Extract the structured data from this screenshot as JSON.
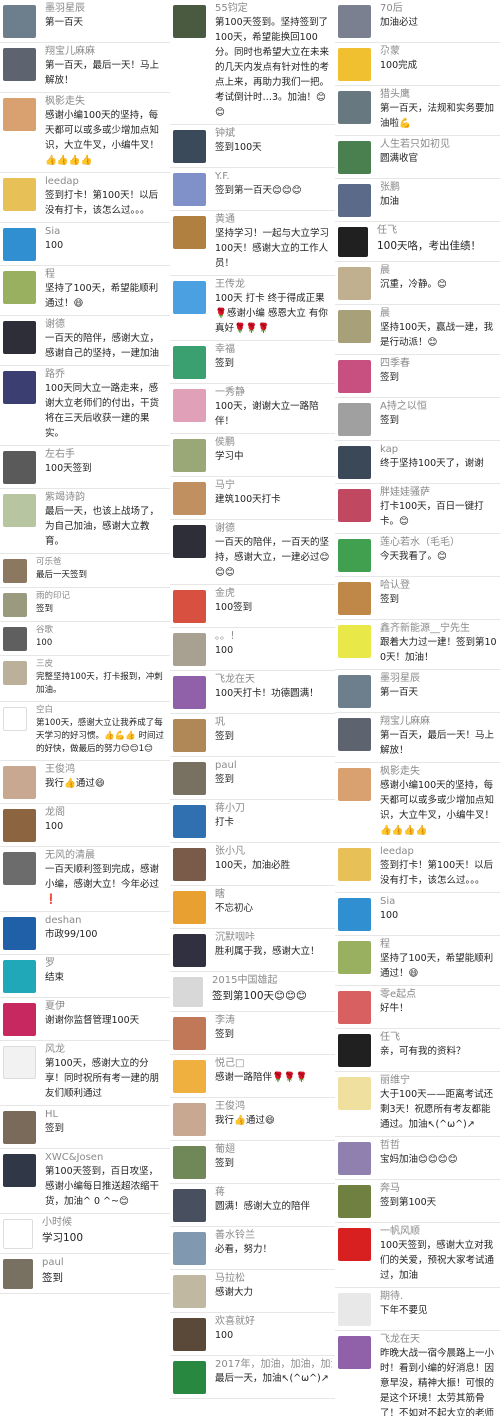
{
  "columns": [
    [
      {
        "name": "墨羽星辰",
        "msg": "第一百天",
        "av": "#6d7f8c"
      },
      {
        "name": "翔宝儿麻麻",
        "msg": "第一百天，最后一天！马上解放！",
        "av": "#5d6470"
      },
      {
        "name": "枫影走失",
        "msg": "感谢小编100天的坚持，每天都可以或多或少增加点知识，大立牛叉，小编牛叉！👍👍👍👍",
        "av": "#d9a070"
      },
      {
        "name": "leedap",
        "msg": "签到打卡！第100天！以后没有打卡，该怎么过。。。",
        "av": "#e8c058"
      },
      {
        "name": "Sia",
        "msg": "100",
        "av": "#2f8fd0"
      },
      {
        "name": "程",
        "msg": "坚持了100天，希望能顺利通过！😄",
        "av": "#98b060"
      },
      {
        "name": "谢德",
        "msg": "一百天的陪伴，感谢大立，感谢自己的坚持，一建加油",
        "av": "#2e2e38"
      },
      {
        "name": "路乔",
        "msg": "100天同大立一路走来，感谢大立老师们的付出，干货将在三天后收获一建的果实。",
        "av": "#3a3e70"
      },
      {
        "name": "左右手",
        "msg": "100天签到",
        "av": "#5a5a5a"
      },
      {
        "name": "紫竭诗韵",
        "msg": "最后一天，也该上战场了，为自己加油，感谢大立教育。",
        "av": "#b7c5a0"
      },
      {
        "name": "可乐爸",
        "msg": "最后一天签到",
        "av": "#8c7760",
        "s": 1
      },
      {
        "name": "雨的印记",
        "msg": "签到",
        "av": "#9a9a7e",
        "s": 1
      },
      {
        "name": "谷歌",
        "msg": "100",
        "av": "#5f5f5f",
        "s": 1
      },
      {
        "name": "三皮",
        "msg": "完整坚持100天，打卡报到，冲刺加油。",
        "av": "#bbb09a",
        "s": 1
      },
      {
        "name": "空白",
        "msg": "第100天，感谢大立让我养成了每天学习的好习惯。👍💪👍 时间过的好快，做最后的努力😊😊1😊",
        "av": "#ffffff",
        "s": 1
      },
      {
        "name": "王俊鸿",
        "msg": "我行👍通过😄",
        "av": "#c8a890"
      },
      {
        "name": "龙阁",
        "msg": "100",
        "av": "#8c6440"
      },
      {
        "name": "无风的清晨",
        "msg": "一百天顺利签到完成，感谢小编，感谢大立！今年必过❗",
        "av": "#6c6c6c"
      },
      {
        "name": "deshan",
        "msg": "市政99/100",
        "av": "#2060a8"
      },
      {
        "name": "罗",
        "msg": "结束",
        "av": "#20a8b8"
      },
      {
        "name": "夏伊",
        "msg": "谢谢你监督管理100天",
        "av": "#c82860"
      },
      {
        "name": "风龙",
        "msg": "第100天，感谢大立的分享！同时祝所有考一建的朋友们顺利通过",
        "av": "#f2f2f2"
      },
      {
        "name": "HL",
        "msg": "签到",
        "av": "#7a6a5a"
      },
      {
        "name": "XWC&Josen",
        "msg": "第100天签到，百日攻坚，感谢小编每日推送超浓缩干货，加油^ 0 ^~😊",
        "av": "#303848"
      },
      {
        "name": "小时候",
        "msg": "学习100",
        "av": "#ffffff",
        "l": 1
      },
      {
        "name": "paul",
        "msg": "签到",
        "av": "#787060",
        "l": 1
      }
    ],
    [
      {
        "name": "55钧定",
        "msg": "第100天签到。坚持签到了100天，希望能换回100分。同时也希望大立在未来的几天内发点有针对性的考点上来，再助力我们一把。考试倒计时…3。加油！😊😊",
        "av": "#4a5a40"
      },
      {
        "name": "钟斌",
        "msg": "签到100天",
        "av": "#3a4a5a"
      },
      {
        "name": "Y.F.",
        "msg": "签到第一百天😊😊😊",
        "av": "#8090c8"
      },
      {
        "name": "黄通",
        "msg": "坚持学习！一起与大立学习100天！感谢大立的工作人员！",
        "av": "#b08040"
      },
      {
        "name": "王传龙",
        "msg": "100天 打卡 终于得成正果🌹感谢小编 感恩大立 有你真好🌹🌹🌹",
        "av": "#4aa0e0"
      },
      {
        "name": "幸福",
        "msg": "签到",
        "av": "#3aa070"
      },
      {
        "name": "一秀静",
        "msg": "100天，谢谢大立一路陪伴！",
        "av": "#e0a0b8"
      },
      {
        "name": "侯鹏",
        "msg": "学习中",
        "av": "#9aa878"
      },
      {
        "name": "马宁",
        "msg": "建筑100天打卡",
        "av": "#c09060"
      },
      {
        "name": "谢德",
        "msg": "一百天的陪伴，一百天的坚持，感谢大立，一建必过😊😊😊",
        "av": "#2e2e38"
      },
      {
        "name": "金虎",
        "msg": "100签到",
        "av": "#d85040"
      },
      {
        "name": "。。！",
        "msg": "100",
        "av": "#a8a090"
      },
      {
        "name": "飞龙在天",
        "msg": "100天打卡！功德圆满！",
        "av": "#9060a8"
      },
      {
        "name": "巩",
        "msg": "签到",
        "av": "#b08858"
      },
      {
        "name": "paul",
        "msg": "签到",
        "av": "#787060"
      },
      {
        "name": "蒋小刀",
        "msg": "打卡",
        "av": "#3070b0"
      },
      {
        "name": "张小凡",
        "msg": "100天，加油必胜",
        "av": "#7a5a48"
      },
      {
        "name": "瞎",
        "msg": "不忘初心",
        "av": "#e8a030"
      },
      {
        "name": "沉默咽咔",
        "msg": "胜利属于我，感谢大立！",
        "av": "#303040"
      },
      {
        "name": "2015中国雄起",
        "msg": "签到第100天😊😊😊",
        "av": "#d8d8d8",
        "l": 1
      },
      {
        "name": "李涛",
        "msg": "签到",
        "av": "#c07858"
      },
      {
        "name": "悦己□",
        "msg": "感谢一路陪伴🌹🌹🌹",
        "av": "#f0b040"
      },
      {
        "name": "王俊鸿",
        "msg": "我行👍通过😄",
        "av": "#c8a890"
      },
      {
        "name": "葡翅",
        "msg": "签到",
        "av": "#708858"
      },
      {
        "name": "蒋",
        "msg": "圆满！感谢大立的陪伴",
        "av": "#485060"
      },
      {
        "name": "善水铃兰",
        "msg": "必看，努力！",
        "av": "#8098b0"
      },
      {
        "name": "马拉松",
        "msg": "感谢大力",
        "av": "#c0b8a0"
      },
      {
        "name": "欢喜就好",
        "msg": "100",
        "av": "#5a4838"
      },
      {
        "name": "2017年，加油，加油，加油",
        "msg": "最后一天，加油↖(^ω^)↗",
        "av": "#288840"
      }
    ],
    [
      {
        "name": "70后",
        "msg": "加油必过",
        "av": "#7a8090"
      },
      {
        "name": "尕蒙",
        "msg": "100完成",
        "av": "#f0c030"
      },
      {
        "name": "猎头鹰",
        "msg": "第一百天，法规和实务要加油啦💪",
        "av": "#687880"
      },
      {
        "name": "人生若只如初见",
        "msg": "圆满收官",
        "av": "#4a8050"
      },
      {
        "name": "张鹏",
        "msg": "加油",
        "av": "#5a6a88"
      },
      {
        "name": "任飞",
        "msg": "100天咯，考出佳绩！",
        "av": "#202020",
        "l": 1
      },
      {
        "name": "晨",
        "msg": "沉重，冷静。😊",
        "av": "#c0b090"
      },
      {
        "name": "晨",
        "msg": "坚持100天，赢战一建，我是行动派！😊",
        "av": "#a8a078"
      },
      {
        "name": "四季春",
        "msg": "签到",
        "av": "#c85080"
      },
      {
        "name": "A持之以恒",
        "msg": "签到",
        "av": "#a0a0a0"
      },
      {
        "name": "kap",
        "msg": "终于坚持100天了，谢谢",
        "av": "#3a4858"
      },
      {
        "name": "胖娃娃骚萨",
        "msg": "打卡100天，百日一键打卡。😊",
        "av": "#c04860"
      },
      {
        "name": "莲心若水（毛毛）",
        "msg": "今天我看了。😊",
        "av": "#40a050"
      },
      {
        "name": "哈认登",
        "msg": "签到",
        "av": "#c08848"
      },
      {
        "name": "鑫齐新能源__宁先生",
        "msg": "跟着大力过一建！签到第100天！加油！",
        "av": "#e8e848"
      },
      {
        "name": "墨羽星辰",
        "msg": "第一百天",
        "av": "#6d7f8c"
      },
      {
        "name": "翔宝儿麻麻",
        "msg": "第一百天，最后一天！马上解放！",
        "av": "#5d6470"
      },
      {
        "name": "枫影走失",
        "msg": "感谢小编100天的坚持，每天都可以或多或少增加点知识，大立牛叉，小编牛叉！👍👍👍👍",
        "av": "#d9a070"
      },
      {
        "name": "leedap",
        "msg": "签到打卡！第100天！以后没有打卡，该怎么过。。。",
        "av": "#e8c058"
      },
      {
        "name": "Sia",
        "msg": "100",
        "av": "#2f8fd0"
      },
      {
        "name": "程",
        "msg": "坚持了100天，希望能顺利通过！😄",
        "av": "#98b060"
      },
      {
        "name": "零e起点",
        "msg": "好牛！",
        "av": "#d86060"
      },
      {
        "name": "任飞",
        "msg": "亲，可有我的资料？",
        "av": "#202020"
      },
      {
        "name": "丽维宁",
        "msg": "大于100天——距离考试还剩3天！祝愿所有考友都能通过。加油↖(^ω^)↗",
        "av": "#f0e0a0"
      },
      {
        "name": "哲哲",
        "msg": "宝妈加油😊😊😊😊",
        "av": "#9080b0"
      },
      {
        "name": "奔马",
        "msg": "签到第100天",
        "av": "#708040"
      },
      {
        "name": "一帆风顺",
        "msg": "100天签到，感谢大立对我们的关爱，预祝大家考试通过，加油",
        "av": "#d82020"
      },
      {
        "name": "期待.",
        "msg": "下年不要见",
        "av": "#e8e8e8"
      },
      {
        "name": "飞龙在天",
        "msg": "昨晚大战一宿今晨路上一小时！看到小编的好消息！因意早没，精神大振！可恨的是这个环境！太劳其筋骨了！不如对不起大立的老师们！谢谢！大立是我的福地！",
        "av": "#9060a8"
      }
    ]
  ]
}
